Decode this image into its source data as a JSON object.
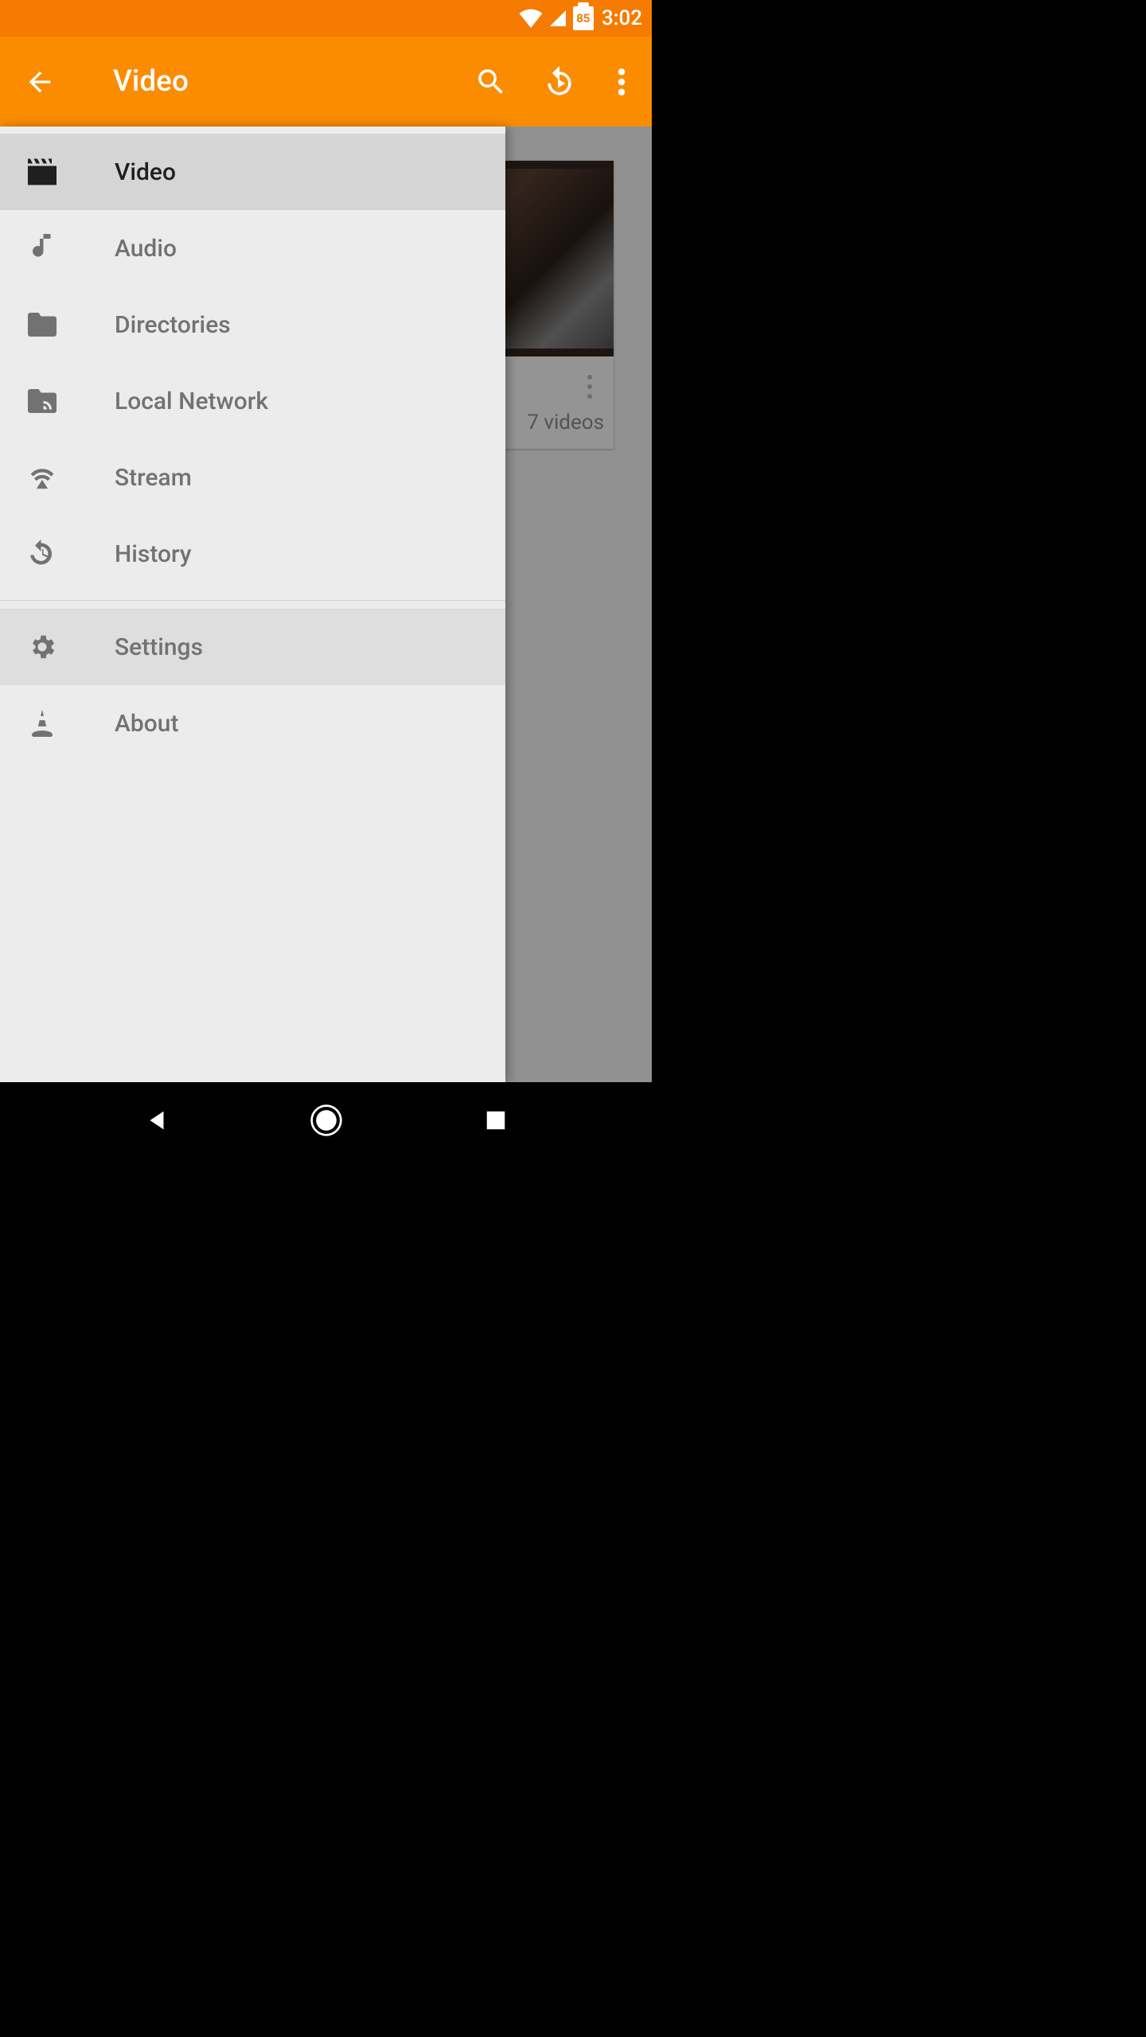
{
  "status": {
    "battery": "85",
    "time": "3:02"
  },
  "header": {
    "title": "Video"
  },
  "drawer": {
    "items": [
      {
        "icon": "video-icon",
        "label": "Video",
        "active": true,
        "press": false
      },
      {
        "icon": "audio-icon",
        "label": "Audio",
        "active": false,
        "press": false
      },
      {
        "icon": "folder-icon",
        "label": "Directories",
        "active": false,
        "press": false
      },
      {
        "icon": "network-icon",
        "label": "Local Network",
        "active": false,
        "press": false
      },
      {
        "icon": "stream-icon",
        "label": "Stream",
        "active": false,
        "press": false
      },
      {
        "icon": "history-icon",
        "label": "History",
        "active": false,
        "press": false
      }
    ],
    "bottom": [
      {
        "icon": "settings-icon",
        "label": "Settings",
        "active": false,
        "press": true
      },
      {
        "icon": "about-icon",
        "label": "About",
        "active": false,
        "press": false
      }
    ]
  },
  "content": {
    "card": {
      "count_label": "7 videos"
    }
  }
}
